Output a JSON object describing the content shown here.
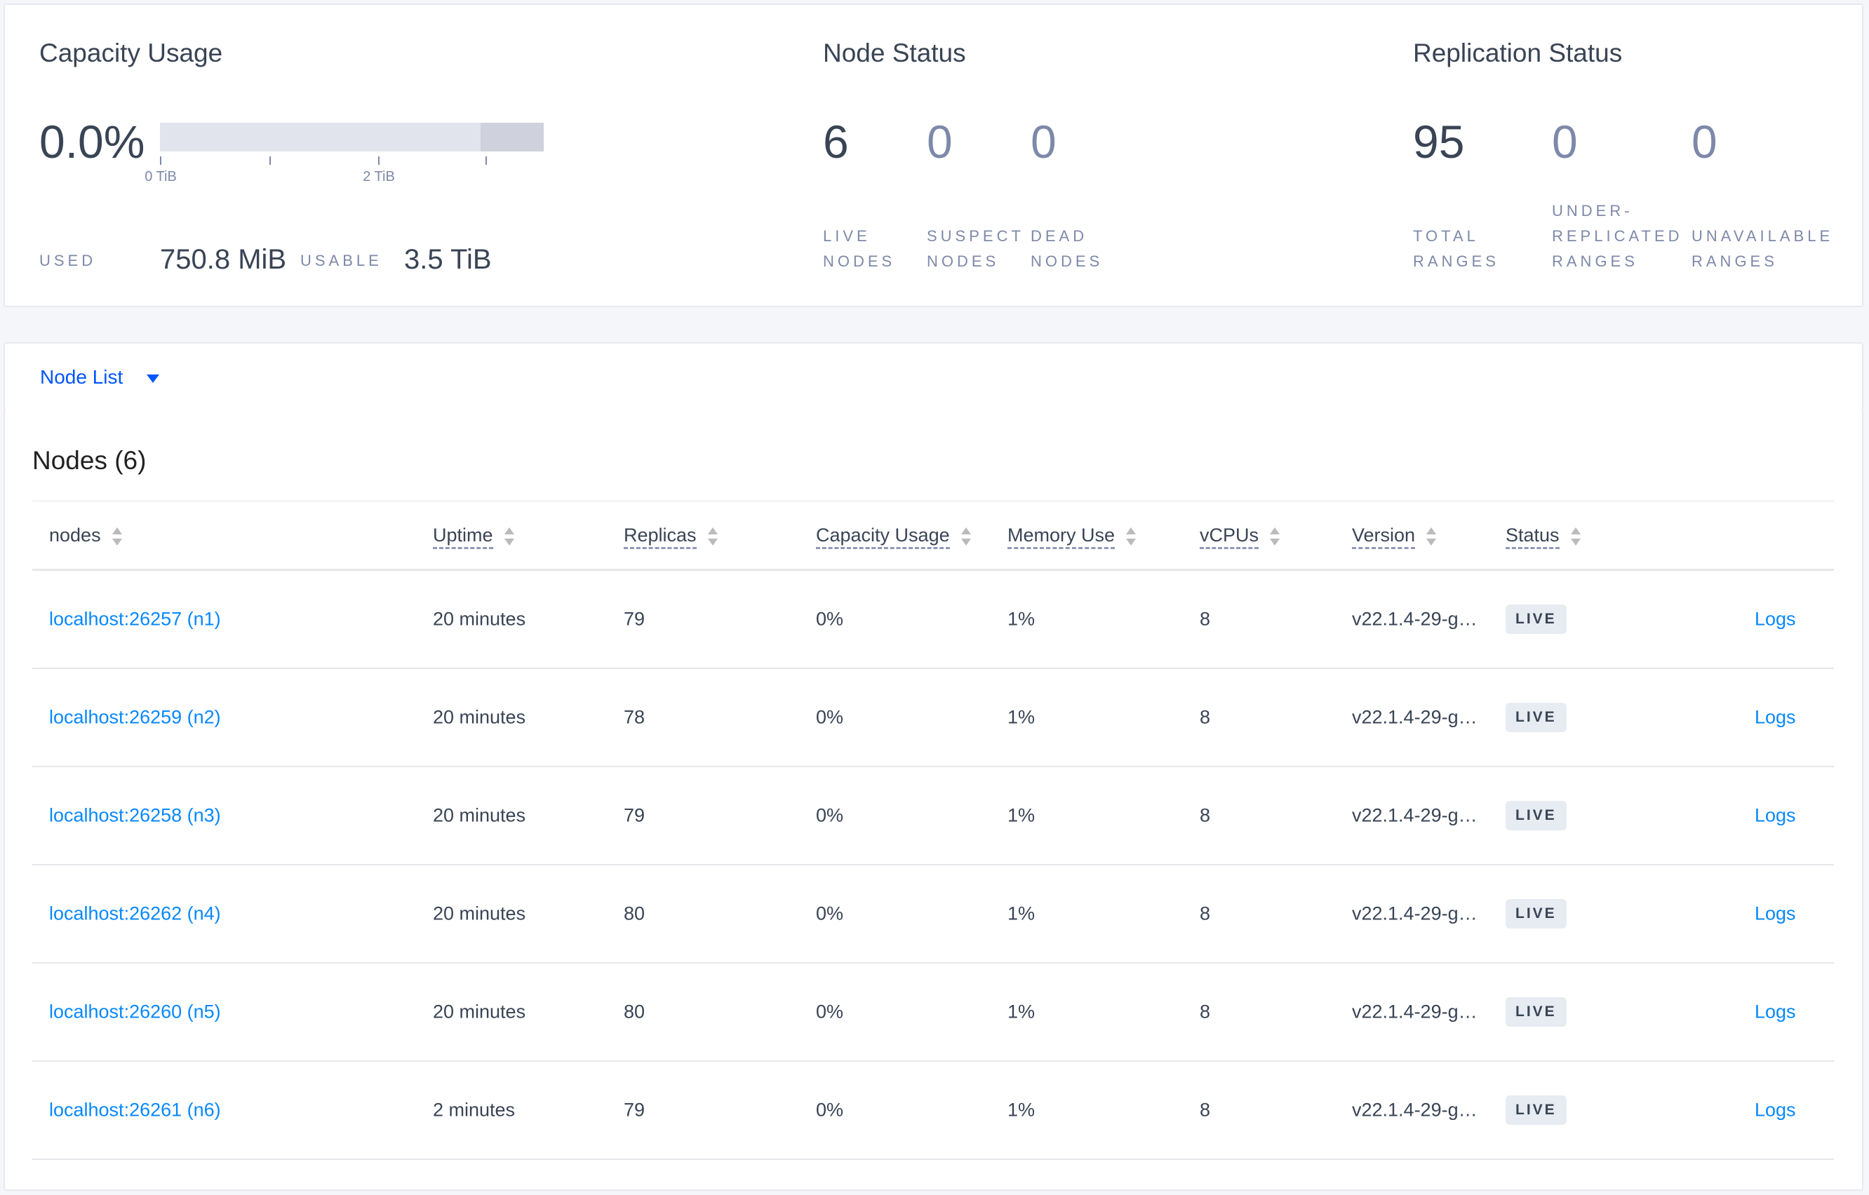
{
  "capacity": {
    "title": "Capacity Usage",
    "percent": "0.0%",
    "used_fraction": 0.0,
    "axis_ticks": [
      "0 TiB",
      "2 TiB"
    ],
    "used_label": "USED",
    "used_value": "750.8 MiB",
    "usable_label": "USABLE",
    "usable_value": "3.5 TiB"
  },
  "node_status": {
    "title": "Node Status",
    "stats": [
      {
        "value": "6",
        "label1": "LIVE",
        "label2": "NODES"
      },
      {
        "value": "0",
        "label1": "SUSPECT",
        "label2": "NODES"
      },
      {
        "value": "0",
        "label1": "DEAD",
        "label2": "NODES"
      }
    ]
  },
  "replication": {
    "title": "Replication Status",
    "stats": [
      {
        "value": "95",
        "label1": "TOTAL",
        "label2": "RANGES"
      },
      {
        "value": "0",
        "label1": "UNDER-",
        "label2": "REPLICATED",
        "label3": "RANGES"
      },
      {
        "value": "0",
        "label1": "UNAVAILABLE",
        "label2": "RANGES"
      }
    ]
  },
  "view_select": {
    "label": "Node List",
    "icon": "caret-down-icon"
  },
  "table": {
    "title": "Nodes (6)",
    "columns": [
      "nodes",
      "Uptime",
      "Replicas",
      "Capacity Usage",
      "Memory Use",
      "vCPUs",
      "Version",
      "Status"
    ],
    "rows": [
      {
        "node": "localhost:26257 (n1)",
        "uptime": "20 minutes",
        "replicas": "79",
        "capacity": "0%",
        "memory": "1%",
        "vcpus": "8",
        "version": "v22.1.4-29-g…",
        "status": "LIVE",
        "logs": "Logs"
      },
      {
        "node": "localhost:26259 (n2)",
        "uptime": "20 minutes",
        "replicas": "78",
        "capacity": "0%",
        "memory": "1%",
        "vcpus": "8",
        "version": "v22.1.4-29-g…",
        "status": "LIVE",
        "logs": "Logs"
      },
      {
        "node": "localhost:26258 (n3)",
        "uptime": "20 minutes",
        "replicas": "79",
        "capacity": "0%",
        "memory": "1%",
        "vcpus": "8",
        "version": "v22.1.4-29-g…",
        "status": "LIVE",
        "logs": "Logs"
      },
      {
        "node": "localhost:26262 (n4)",
        "uptime": "20 minutes",
        "replicas": "80",
        "capacity": "0%",
        "memory": "1%",
        "vcpus": "8",
        "version": "v22.1.4-29-g…",
        "status": "LIVE",
        "logs": "Logs"
      },
      {
        "node": "localhost:26260 (n5)",
        "uptime": "20 minutes",
        "replicas": "80",
        "capacity": "0%",
        "memory": "1%",
        "vcpus": "8",
        "version": "v22.1.4-29-g…",
        "status": "LIVE",
        "logs": "Logs"
      },
      {
        "node": "localhost:26261 (n6)",
        "uptime": "2 minutes",
        "replicas": "79",
        "capacity": "0%",
        "memory": "1%",
        "vcpus": "8",
        "version": "v22.1.4-29-g…",
        "status": "LIVE",
        "logs": "Logs"
      }
    ]
  },
  "colors": {
    "text": "#394455",
    "muted": "#7e89a9",
    "link": "#0788ff",
    "accent": "#0055ff",
    "badge_bg": "#e7ebf2"
  }
}
